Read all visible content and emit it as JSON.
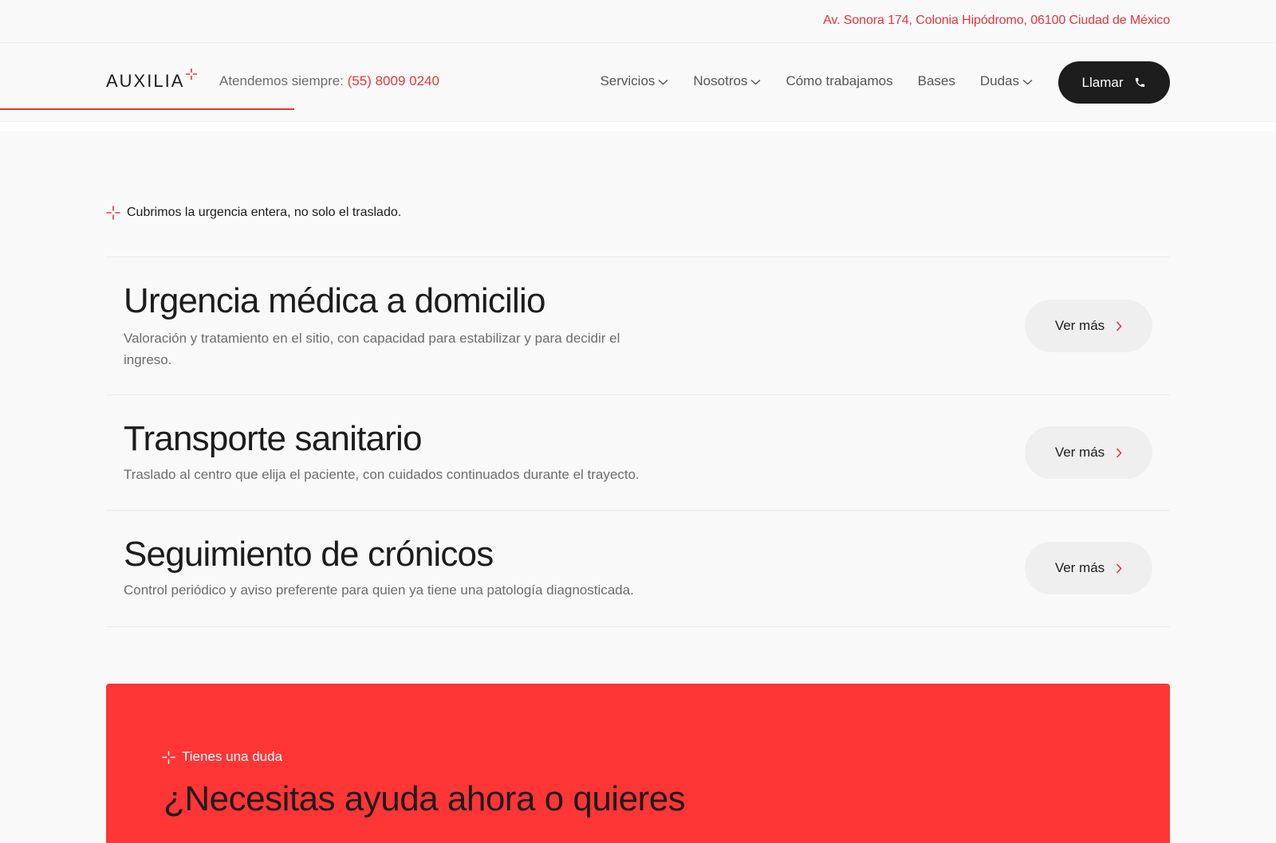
{
  "topbar": {
    "address": "Av. Sonora 174, Colonia Hipódromo, 06100 Ciudad de México"
  },
  "header": {
    "logo_text": "AUXILIA",
    "hotline_label": "Atendemos siempre: ",
    "hotline_phone": "(55) 8009 0240",
    "nav": [
      {
        "label": "Servicios",
        "dropdown": true
      },
      {
        "label": "Nosotros",
        "dropdown": true
      },
      {
        "label": "Cómo trabajamos",
        "dropdown": false
      },
      {
        "label": "Bases",
        "dropdown": false
      },
      {
        "label": "Dudas",
        "dropdown": true
      }
    ],
    "call_label": "Llamar"
  },
  "services": {
    "eyebrow": "Cubrimos la urgencia entera, no solo el traslado.",
    "items": [
      {
        "title": "Urgencia médica a domicilio",
        "description": "Valoración y tratamiento en el sitio, con capacidad para estabilizar y para decidir el ingreso.",
        "button": "Ver más"
      },
      {
        "title": "Transporte sanitario",
        "description": "Traslado al centro que elija el paciente, con cuidados continuados durante el trayecto.",
        "button": "Ver más"
      },
      {
        "title": "Seguimiento de crónicos",
        "description": "Control periódico y aviso preferente para quien ya tiene una patología diagnosticada.",
        "button": "Ver más"
      }
    ]
  },
  "cta": {
    "eyebrow": "Tienes una duda",
    "title": "¿Necesitas ayuda ahora o quieres"
  },
  "colors": {
    "accent": "#e5363a",
    "cta_background": "#ff3536",
    "dark_button": "#1d1d1d"
  }
}
